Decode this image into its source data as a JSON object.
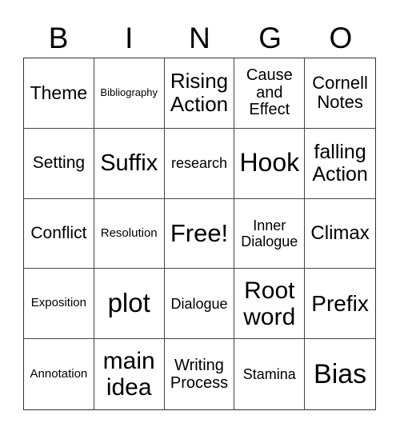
{
  "header": {
    "letters": [
      "B",
      "I",
      "N",
      "G",
      "O"
    ]
  },
  "board": {
    "rows": [
      [
        {
          "text": "Theme",
          "size": "m"
        },
        {
          "text": "Bibliography",
          "size": "xs"
        },
        {
          "text": "Rising\nAction",
          "size": "l"
        },
        {
          "text": "Cause\nand\nEffect",
          "size": "s"
        },
        {
          "text": "Cornell\nNotes",
          "size": "m"
        }
      ],
      [
        {
          "text": "Setting",
          "size": "m"
        },
        {
          "text": "Suffix",
          "size": "l"
        },
        {
          "text": "research",
          "size": "s"
        },
        {
          "text": "Hook",
          "size": "xl"
        },
        {
          "text": "falling\nAction",
          "size": "l"
        }
      ],
      [
        {
          "text": "Conflict",
          "size": "m"
        },
        {
          "text": "Resolution",
          "size": "xs"
        },
        {
          "text": "Free!",
          "size": "xl"
        },
        {
          "text": "Inner\nDialogue",
          "size": "s"
        },
        {
          "text": "Climax",
          "size": "m"
        }
      ],
      [
        {
          "text": "Exposition",
          "size": "xs"
        },
        {
          "text": "plot",
          "size": "xl"
        },
        {
          "text": "Dialogue",
          "size": "s"
        },
        {
          "text": "Root\nword",
          "size": "xl"
        },
        {
          "text": "Prefix",
          "size": "l"
        }
      ],
      [
        {
          "text": "Annotation",
          "size": "xs"
        },
        {
          "text": "main\nidea",
          "size": "xl"
        },
        {
          "text": "Writing\nProcess",
          "size": "s"
        },
        {
          "text": "Stamina",
          "size": "s"
        },
        {
          "text": "Bias",
          "size": "xl"
        }
      ]
    ]
  }
}
